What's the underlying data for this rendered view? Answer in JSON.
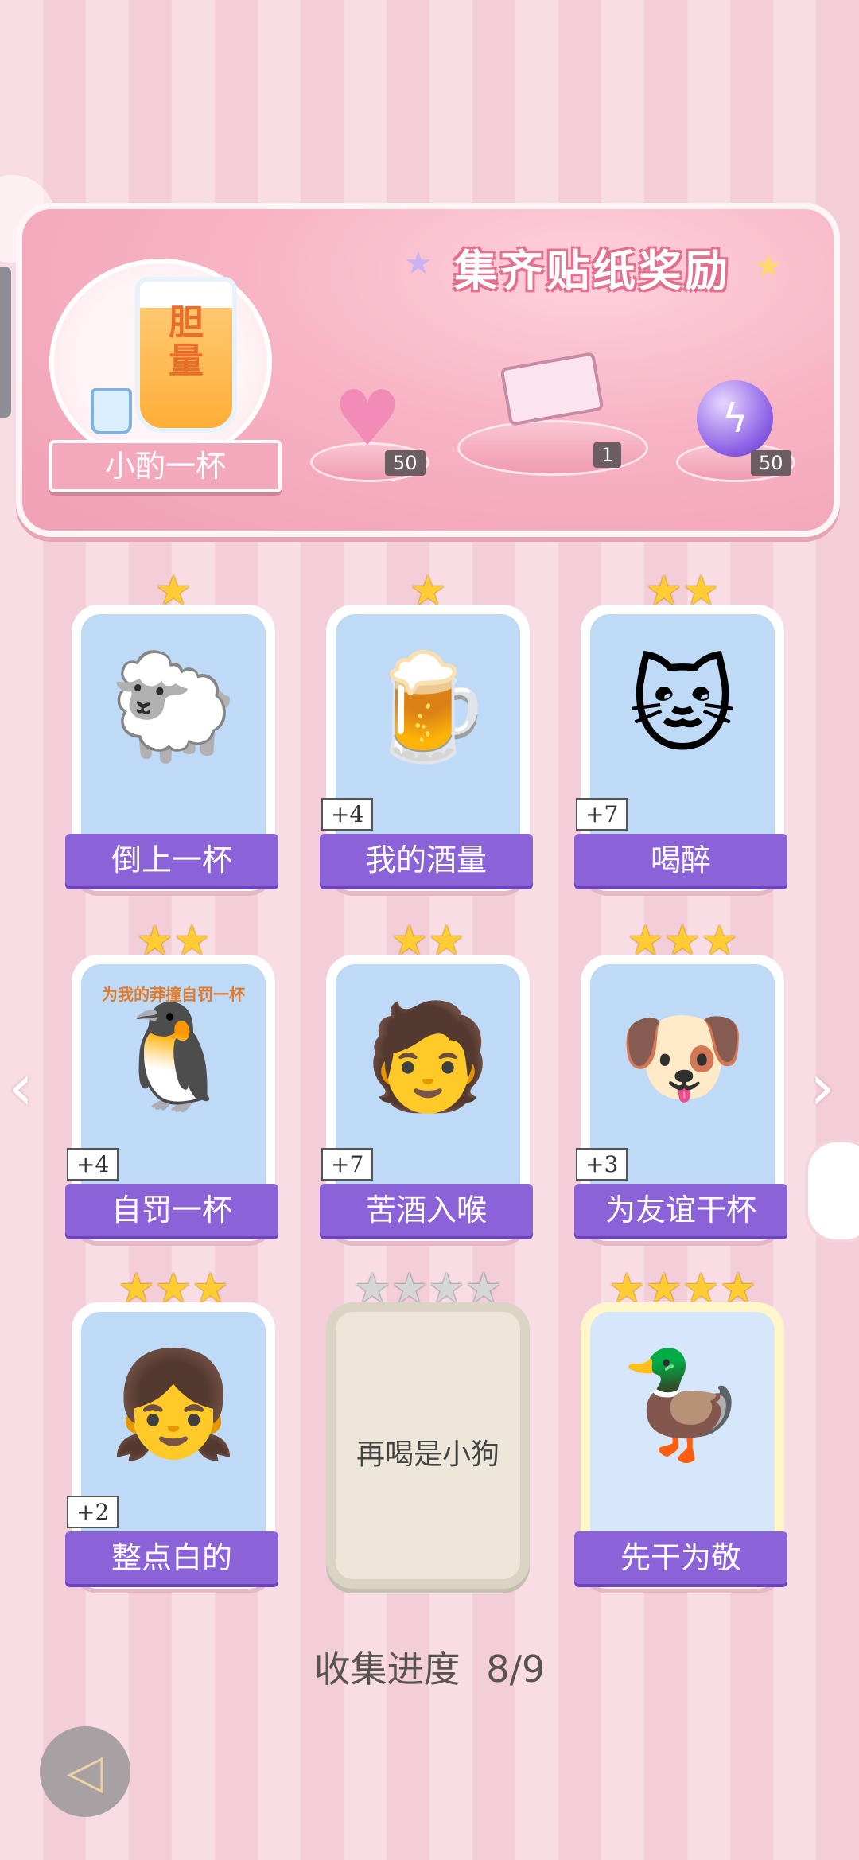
{
  "reward": {
    "title": "集齐贴纸奖励",
    "main_label": "小酌一杯",
    "main_beer_text": "胆\n量",
    "items": [
      {
        "icon": "heart-gem-icon",
        "count": "50"
      },
      {
        "icon": "gift-box-icon",
        "count": "1"
      },
      {
        "icon": "energy-orb-icon",
        "count": "50"
      }
    ]
  },
  "cards": [
    {
      "stars": 1,
      "label": "倒上一杯",
      "bonus": "",
      "art": "🐑",
      "state": "normal"
    },
    {
      "stars": 1,
      "label": "我的酒量",
      "bonus": "+4",
      "art": "🍺",
      "state": "normal"
    },
    {
      "stars": 2,
      "label": "喝醉",
      "bonus": "+7",
      "art": "🐱",
      "state": "normal"
    },
    {
      "stars": 2,
      "label": "自罚一杯",
      "bonus": "+4",
      "art": "🐧",
      "state": "normal"
    },
    {
      "stars": 2,
      "label": "苦酒入喉",
      "bonus": "+7",
      "art": "🧑",
      "state": "normal"
    },
    {
      "stars": 3,
      "label": "为友谊干杯",
      "bonus": "+3",
      "art": "🐶",
      "state": "normal"
    },
    {
      "stars": 3,
      "label": "整点白的",
      "bonus": "+2",
      "art": "👧",
      "state": "normal"
    },
    {
      "stars": 4,
      "label": "再喝是小狗",
      "bonus": "",
      "art": "",
      "state": "locked"
    },
    {
      "stars": 4,
      "label": "先干为敬",
      "bonus": "",
      "art": "🦆",
      "state": "gold"
    }
  ],
  "card4_caption": "为我的莽撞自罚一杯",
  "progress": {
    "label": "收集进度",
    "value": "8/9"
  },
  "nav": {
    "left": "‹",
    "right": "›"
  }
}
